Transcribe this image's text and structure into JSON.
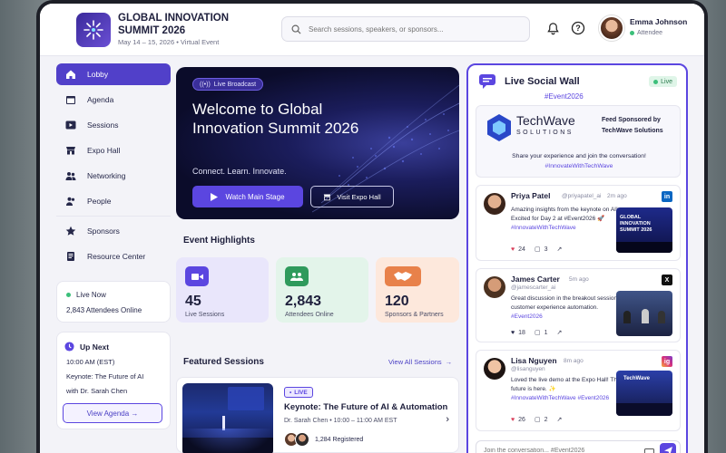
{
  "header": {
    "event_title": "GLOBAL INNOVATION SUMMIT 2026",
    "event_dates": "May 14 – 15, 2026  •  Virtual Event",
    "search_placeholder": "Search sessions, speakers, or sponsors...",
    "user_name": "Emma Johnson",
    "user_role": "Attendee"
  },
  "sidebar": {
    "items": [
      {
        "label": "Lobby",
        "icon": "home-icon",
        "active": true
      },
      {
        "label": "Agenda",
        "icon": "calendar-icon"
      },
      {
        "label": "Sessions",
        "icon": "play-icon"
      },
      {
        "label": "Expo Hall",
        "icon": "store-icon"
      },
      {
        "label": "Networking",
        "icon": "users-icon"
      },
      {
        "label": "People",
        "icon": "people-icon"
      },
      {
        "label": "Sponsors",
        "icon": "star-icon"
      },
      {
        "label": "Resource Center",
        "icon": "document-icon"
      }
    ],
    "live_now_label": "Live Now",
    "attendees_online": "2,843 Attendees Online",
    "up_next_label": "Up Next",
    "up_next_time": "10:00 AM (EST)",
    "up_next_title": "Keynote: The Future of AI",
    "up_next_speaker": "with Dr. Sarah Chen",
    "view_agenda": "View Agenda →"
  },
  "hero": {
    "pill": "Live Broadcast",
    "title": "Welcome to Global Innovation Summit 2026",
    "tagline": "Connect. Learn. Innovate.",
    "watch_button": "Watch Main Stage",
    "expo_button": "Visit Expo Hall"
  },
  "highlights": {
    "title": "Event Highlights",
    "cards": [
      {
        "value": "45",
        "label": "Live Sessions",
        "color": "#e9e6fb",
        "icon_color": "#5b46e0"
      },
      {
        "value": "2,843",
        "label": "Attendees Online",
        "color": "#e3f4ea",
        "icon_color": "#2f9a5c"
      },
      {
        "value": "120",
        "label": "Sponsors & Partners",
        "color": "#fde8dc",
        "icon_color": "#e8814a"
      }
    ]
  },
  "featured": {
    "title": "Featured Sessions",
    "view_all": "View All Sessions",
    "session_badge": "LIVE",
    "session_title": "Keynote: The Future of AI & Automation",
    "session_meta": "Dr. Sarah Chen  •  10:00 – 11:00 AM EST",
    "registered": "1,284 Registered"
  },
  "wall": {
    "title": "Live Social Wall",
    "live": "Live",
    "hashtag": "#Event2026",
    "sponsor_name": "TechWave",
    "sponsor_sub": "SOLUTIONS",
    "sponsored_by": "Feed Sponsored by",
    "sponsor_full": "TechWave Solutions",
    "share_text": "Share your experience and join the conversation!",
    "share_tag": "#InnovateWithTechWave",
    "posts": [
      {
        "name": "Priya Patel",
        "handle": "@priyapatel_ai",
        "time": "2m ago",
        "text": "Amazing insights from the keynote on AI! Excited for Day 2 at #Event2026 🚀",
        "tag": "#InnovateWithTechWave",
        "likes": "24",
        "comments": "3",
        "network": "in"
      },
      {
        "name": "James Carter",
        "handle": "@jamescarter_ai",
        "time": "5m ago",
        "text": "Great discussion in the breakout session on customer experience automation.",
        "tag": "#Event2026",
        "likes": "18",
        "comments": "1",
        "network": "X"
      },
      {
        "name": "Lisa Nguyen",
        "handle": "@lisanguyen",
        "time": "8m ago",
        "text": "Loved the live demo at the Expo Hall! The future is here. ✨",
        "tag": "#InnovateWithTechWave #Event2026",
        "likes": "26",
        "comments": "2",
        "network": "ig"
      }
    ],
    "compose_placeholder": "Join the conversation... #Event2026"
  },
  "post_image_text": {
    "p1_line1": "GLOBAL",
    "p1_line2": "INNOVATION",
    "p1_line3": "SUMMIT 2026",
    "p3_logo": "TechWave"
  }
}
